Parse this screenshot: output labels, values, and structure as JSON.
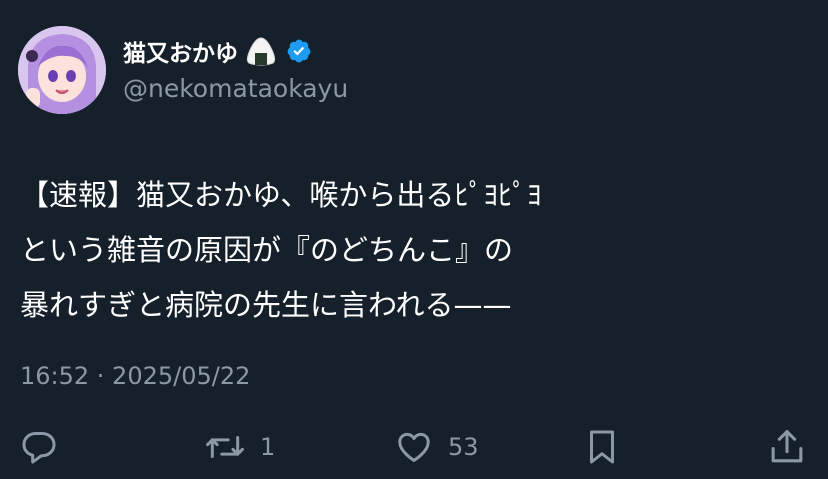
{
  "author": {
    "display_name": "猫又おかゆ",
    "handle": "@nekomataokayu",
    "verified": true,
    "name_emoji": "onigiri-icon"
  },
  "tweet": {
    "lines": [
      "【速報】猫又おかゆ、喉から出るﾋﾟﾖﾋﾟﾖ",
      "という雑音の原因が『のどちんこ』の",
      "暴れすぎと病院の先生に言われる——"
    ],
    "timestamp": "16:52 · 2025/05/22"
  },
  "actions": {
    "reply": {
      "icon": "reply-icon"
    },
    "retweet": {
      "icon": "retweet-icon",
      "count": "1"
    },
    "like": {
      "icon": "like-icon",
      "count": "53"
    },
    "bookmark": {
      "icon": "bookmark-icon"
    },
    "share": {
      "icon": "share-icon"
    }
  },
  "colors": {
    "background": "#15202b",
    "primary_text": "#ffffff",
    "secondary_text": "#8b98a5",
    "verified": "#1d9bf0"
  }
}
